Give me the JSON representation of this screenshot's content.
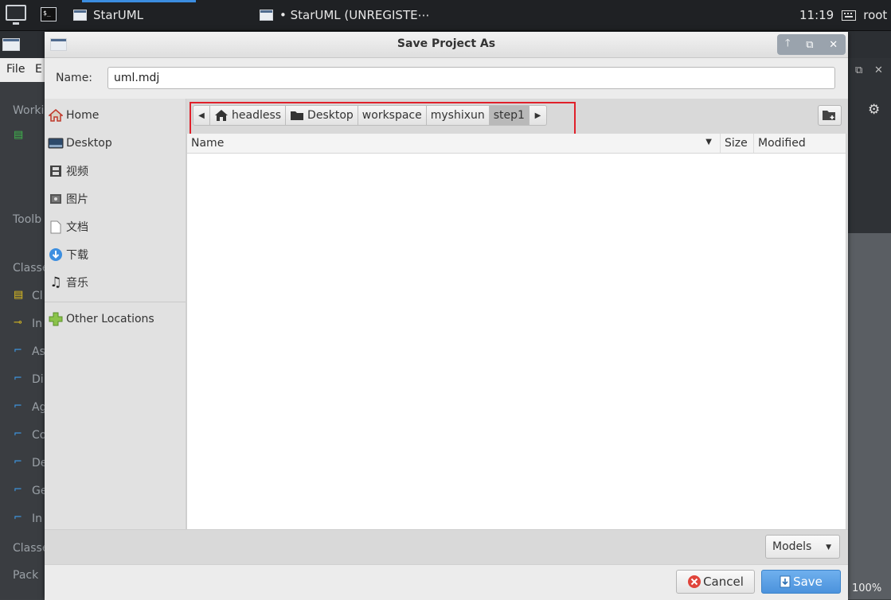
{
  "taskbar": {
    "apps": [
      {
        "label": "StarUML"
      },
      {
        "label": "• StarUML (UNREGISTE⋯"
      }
    ],
    "clock": "11:19",
    "user": "root"
  },
  "background_app": {
    "menu": {
      "file": "File",
      "edit": "E"
    },
    "left_panel": {
      "working": "Worki",
      "toolbox": "Toolb",
      "classes_header": "Classe",
      "items": [
        "Cl",
        "In",
        "As",
        "Di",
        "Ag",
        "Co",
        "De",
        "Ge",
        "In"
      ],
      "classes_footer": "Classe",
      "packages": "Pack"
    },
    "zoom": "100%"
  },
  "dialog": {
    "title": "Save Project As",
    "name_label": "Name:",
    "name_value": "uml.mdj",
    "places": [
      {
        "label": "Home",
        "icon": "home-icon"
      },
      {
        "label": "Desktop",
        "icon": "desktop-icon"
      },
      {
        "label": "视频",
        "icon": "film-icon"
      },
      {
        "label": "图片",
        "icon": "picture-icon"
      },
      {
        "label": "文档",
        "icon": "document-icon"
      },
      {
        "label": "下载",
        "icon": "download-icon"
      },
      {
        "label": "音乐",
        "icon": "music-icon"
      }
    ],
    "other_locations": "Other Locations",
    "path": [
      "headless",
      "Desktop",
      "workspace",
      "myshixun",
      "step1"
    ],
    "columns": {
      "name": "Name",
      "size": "Size",
      "modified": "Modified"
    },
    "filter_value": "Models",
    "cancel_label": "Cancel",
    "save_label": "Save"
  },
  "colors": {
    "highlight": "#e0202a",
    "save_button": "#4b92dc",
    "taskbar_accent": "#3b8de0"
  }
}
